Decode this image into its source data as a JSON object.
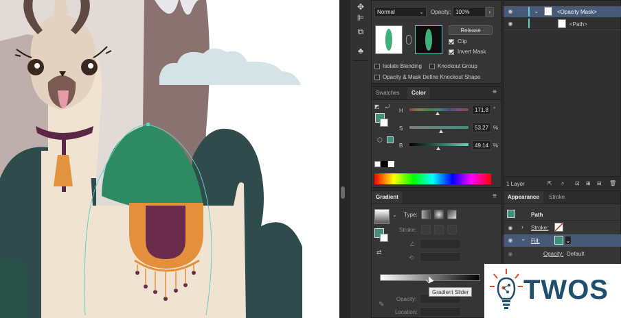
{
  "transparency": {
    "blend_mode": "Normal",
    "opacity_label": "Opacity:",
    "opacity_value": "100%",
    "release_button": "Release",
    "clip_label": "Clip",
    "invert_mask_label": "Invert Mask",
    "isolate_blending_label": "Isolate Blending",
    "knockout_group_label": "Knockout Group",
    "opacity_mask_label": "Opacity & Mask Define Knockout Shape",
    "clip_checked": true,
    "invert_checked": true
  },
  "layers": {
    "rows": [
      {
        "label": "<Opacity Mask>"
      },
      {
        "label": "<Path>"
      }
    ],
    "footer_label": "1 Layer"
  },
  "color_panel": {
    "tabs": [
      "Swatches",
      "Color"
    ],
    "active_tab": "Color",
    "h_label": "H",
    "s_label": "S",
    "b_label": "B",
    "h_value": "171.8",
    "s_value": "53.27",
    "b_value": "49.14",
    "h_unit": "°",
    "s_unit": "%",
    "b_unit": "%",
    "h_fraction": 0.477,
    "s_fraction": 0.533,
    "b_fraction": 0.491
  },
  "gradient_panel": {
    "tab": "Gradient",
    "type_label": "Type:",
    "stroke_label": "Stroke:",
    "opacity_label": "Opacity:",
    "location_label": "Location:",
    "tooltip": "Gradient Slider"
  },
  "appearance_panel": {
    "tabs": [
      "Appearance",
      "Stroke"
    ],
    "active_tab": "Appearance",
    "object_label": "Path",
    "stroke_label": "Stroke:",
    "fill_label": "Fill:",
    "opacity_label": "Opacity:",
    "opacity_value": "Default"
  },
  "watermark": {
    "text": "TWOS"
  },
  "colors": {
    "teal_fill": "#3f8f7a",
    "selection": "#465a78",
    "llama_body": "#f1e3d2",
    "llama_head": "#e4d2c1",
    "collar": "#5c2746",
    "bell": "#e39340",
    "mountain_dark": "#2f4b4c",
    "mountain_brown": "#8a7271",
    "saddle_orange": "#e38f3c",
    "saddle_purple": "#6b2b4d",
    "cloud": "#d6e3e6",
    "green_blob": "#2e8a63"
  },
  "icons": [
    "eye-icon",
    "chain-link-icon",
    "swap-icon",
    "none-swatch-icon",
    "menu-icon",
    "search-icon",
    "new-layer-icon",
    "trash-icon",
    "chevron-right-icon",
    "chevron-down-icon",
    "eyedropper-icon"
  ]
}
